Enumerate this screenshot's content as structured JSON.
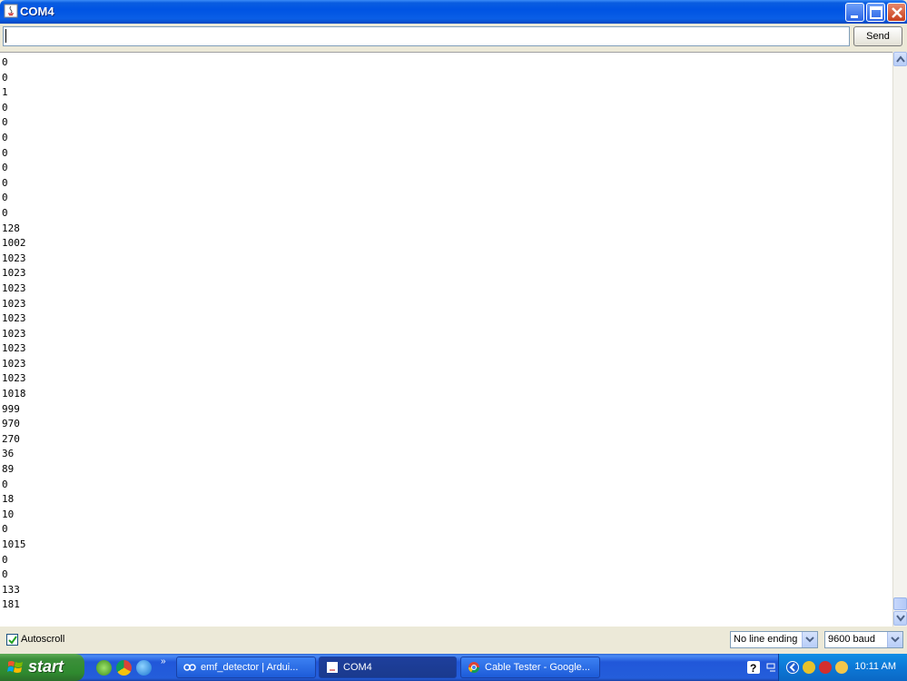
{
  "window": {
    "title": "COM4",
    "icon": "java-icon",
    "controls": [
      "minimize-icon",
      "maximize-icon",
      "close-icon"
    ]
  },
  "send_row": {
    "input_value": "",
    "send_label": "Send"
  },
  "output": {
    "lines": [
      "0",
      "0",
      "1",
      "0",
      "0",
      "0",
      "0",
      "0",
      "0",
      "0",
      "0",
      "128",
      "1002",
      "1023",
      "1023",
      "1023",
      "1023",
      "1023",
      "1023",
      "1023",
      "1023",
      "1023",
      "1018",
      "999",
      "970",
      "270",
      "36",
      "89",
      "0",
      "18",
      "10",
      "0",
      "1015",
      "0",
      "0",
      "133",
      "181"
    ]
  },
  "bottom": {
    "autoscroll_label": "Autoscroll",
    "autoscroll_checked": true,
    "line_ending_selected": "No line ending",
    "baud_selected": "9600 baud"
  },
  "taskbar": {
    "start_label": "start",
    "quick_launch": [
      "utorrent-icon",
      "chrome-icon",
      "ie-icon"
    ],
    "chevron": "»",
    "buttons": [
      {
        "label": "emf_detector | Ardui...",
        "icon": "arduino-icon"
      },
      {
        "label": "COM4",
        "icon": "java-icon"
      },
      {
        "label": "Cable Tester - Google...",
        "icon": "chrome-icon"
      }
    ],
    "tray_icons": [
      "help-icon",
      "network-icon",
      "arrow-left-icon",
      "shield-icon",
      "antivirus-icon",
      "avatar-icon"
    ],
    "clock": "10:11 AM"
  },
  "colors": {
    "title_bar": "#0054e3",
    "taskbar": "#245edb",
    "start_button": "#3c8f3a"
  }
}
